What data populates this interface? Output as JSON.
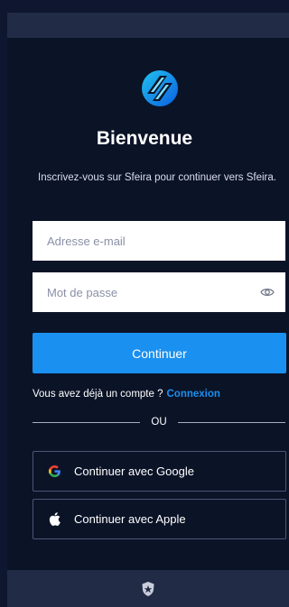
{
  "auth": {
    "title": "Bienvenue",
    "subtitle": "Inscrivez-vous sur Sfeira pour continuer vers Sfeira.",
    "email_placeholder": "Adresse e-mail",
    "password_placeholder": "Mot de passe",
    "continue_label": "Continuer",
    "have_account_text": "Vous avez déjà un compte ?",
    "login_link_label": "Connexion",
    "or_text": "OU",
    "google_label": "Continuer avec Google",
    "apple_label": "Continuer avec Apple"
  },
  "icons": {
    "logo": "sfeira-logo",
    "password_toggle": "eye-icon",
    "google": "google-icon",
    "apple": "apple-icon",
    "footer": "shield-icon"
  },
  "colors": {
    "background": "#0b1327",
    "accent": "#1a90f0",
    "frame": "#222b45"
  }
}
